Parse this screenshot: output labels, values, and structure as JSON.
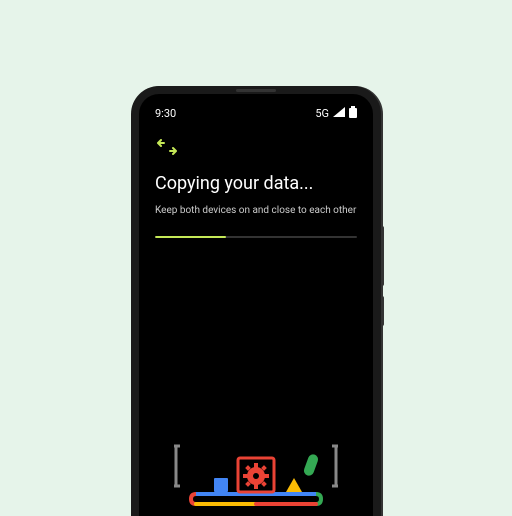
{
  "statusBar": {
    "time": "9:30",
    "network": "5G"
  },
  "screen": {
    "title": "Copying your data...",
    "subtitle": "Keep both devices on and close to each other"
  },
  "progress": {
    "percent": 35
  },
  "icons": {
    "transfer": "transfer-arrows",
    "signal": "signal",
    "battery": "battery"
  },
  "colors": {
    "accent": "#c5e857",
    "background": "#000000",
    "pageBackground": "#e6f4ea"
  }
}
